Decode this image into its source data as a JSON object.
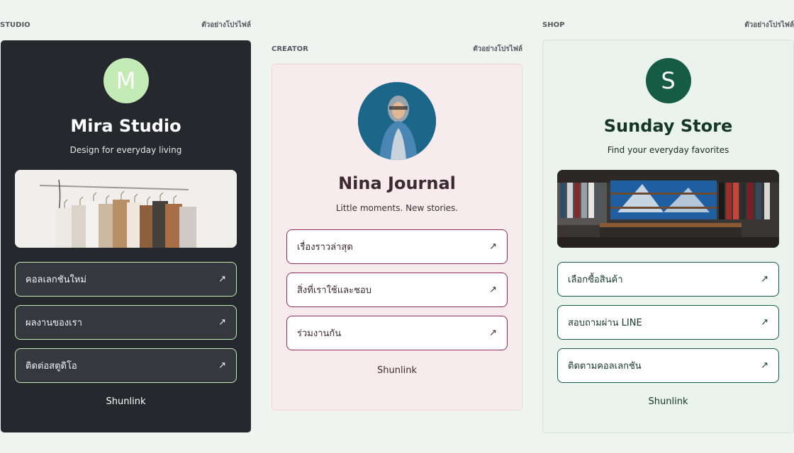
{
  "colors": {
    "page_bg": "#eff4f1",
    "studio_bg": "#25282c",
    "studio_accent": "#c4eab6",
    "creator_bg": "#f8ebee",
    "creator_accent": "#8f2d5a",
    "shop_bg": "#eaf3ee",
    "shop_accent": "#165b43"
  },
  "studio": {
    "category": "STUDIO",
    "preview_label": "ตัวอย่างโปรไฟล์",
    "avatar_letter": "M",
    "name": "Mira Studio",
    "tagline": "Design for everyday living",
    "banner": "clothing-rack-image",
    "links": [
      {
        "label": "คอลเลกชันใหม่",
        "icon": "external-arrow-icon",
        "arrow": "↗"
      },
      {
        "label": "ผลงานของเรา",
        "icon": "external-arrow-icon",
        "arrow": "↗"
      },
      {
        "label": "ติดต่อสตูดิโอ",
        "icon": "external-arrow-icon",
        "arrow": "↗"
      }
    ],
    "brand": "Shunlink"
  },
  "creator": {
    "category": "CREATOR",
    "preview_label": "ตัวอย่างโปรไฟล์",
    "avatar": "creator-portrait-photo",
    "name": "Nina Journal",
    "tagline": "Little moments. New stories.",
    "links": [
      {
        "label": "เรื่องราวล่าสุด",
        "icon": "external-arrow-icon",
        "arrow": "↗"
      },
      {
        "label": "สิ่งที่เราใช้และชอบ",
        "icon": "external-arrow-icon",
        "arrow": "↗"
      },
      {
        "label": "ร่วมงานกัน",
        "icon": "external-arrow-icon",
        "arrow": "↗"
      }
    ],
    "brand": "Shunlink"
  },
  "shop": {
    "category": "SHOP",
    "preview_label": "ตัวอย่างโปรไฟล์",
    "avatar_letter": "S",
    "name": "Sunday Store",
    "tagline": "Find your everyday favorites",
    "banner": "store-interior-image",
    "links": [
      {
        "label": "เลือกซื้อสินค้า",
        "icon": "external-arrow-icon",
        "arrow": "↗"
      },
      {
        "label": "สอบถามผ่าน LINE",
        "icon": "external-arrow-icon",
        "arrow": "↗"
      },
      {
        "label": "ติดตามคอลเลกชัน",
        "icon": "external-arrow-icon",
        "arrow": "↗"
      }
    ],
    "brand": "Shunlink"
  }
}
